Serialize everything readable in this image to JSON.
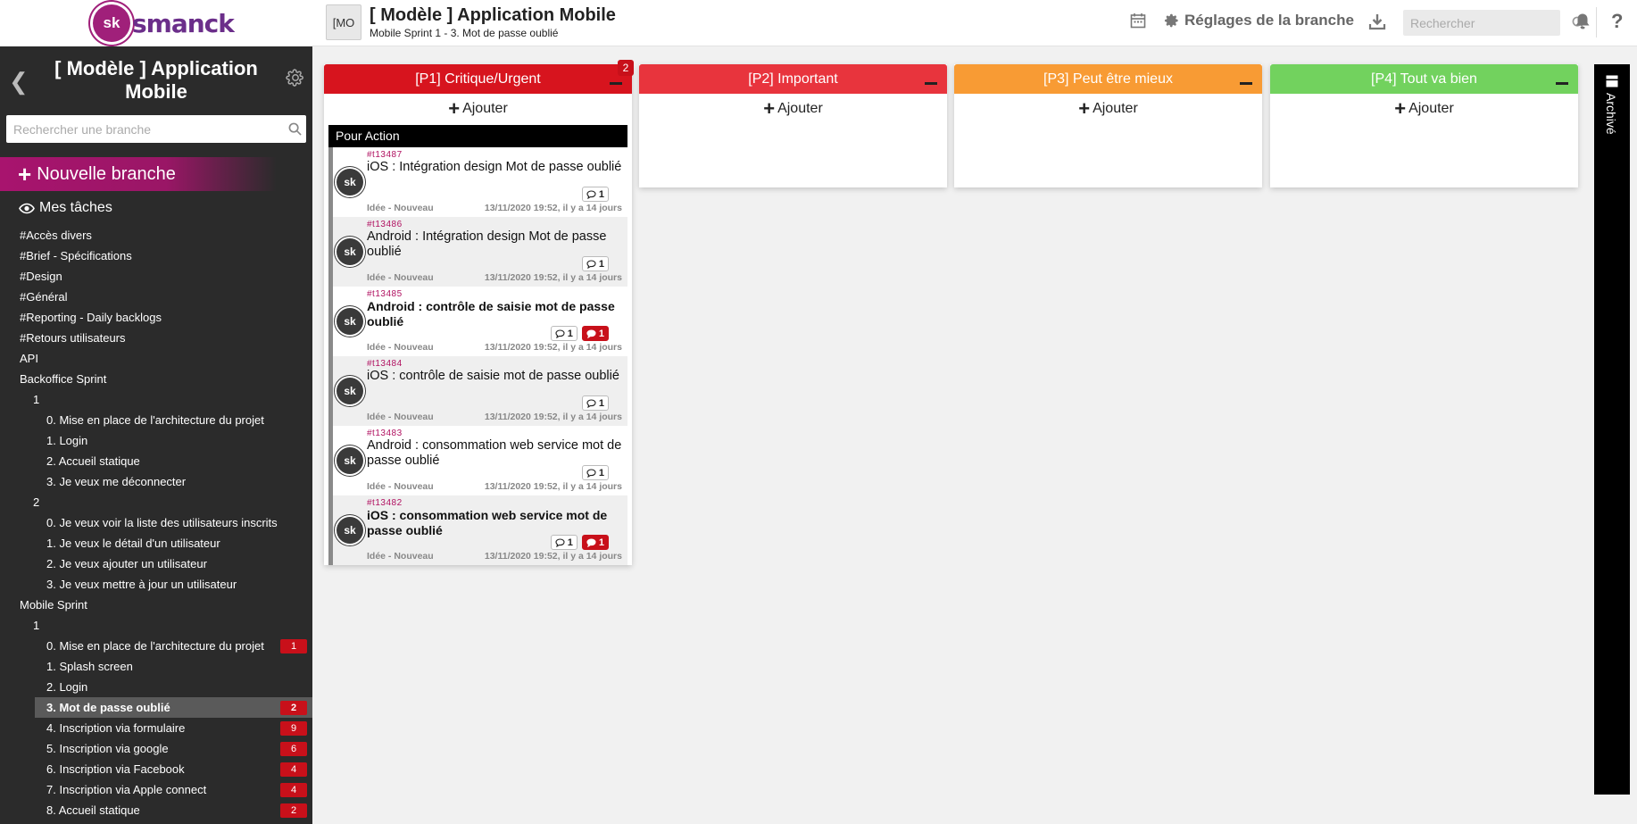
{
  "app": {
    "logo_mark": "sk",
    "logo_text": "smanck",
    "accent": "#a8146e"
  },
  "sidebar": {
    "title": "[ Modèle ] Application Mobile",
    "search_placeholder": "Rechercher une branche",
    "new_branch_label": "Nouvelle branche",
    "my_tasks_label": "Mes tâches",
    "items": [
      {
        "label": "#Accès divers",
        "level": 0,
        "badge": ""
      },
      {
        "label": "#Brief - Spécifications",
        "level": 0,
        "badge": ""
      },
      {
        "label": "#Design",
        "level": 0,
        "badge": ""
      },
      {
        "label": "#Général",
        "level": 0,
        "badge": ""
      },
      {
        "label": "#Reporting - Daily backlogs",
        "level": 0,
        "badge": ""
      },
      {
        "label": "#Retours utilisateurs",
        "level": 0,
        "badge": ""
      },
      {
        "label": "API",
        "level": 0,
        "badge": ""
      },
      {
        "label": "Backoffice Sprint",
        "level": 0,
        "badge": ""
      },
      {
        "label": "1",
        "level": 1,
        "badge": ""
      },
      {
        "label": "0. Mise en place de l'architecture du projet",
        "level": 2,
        "badge": ""
      },
      {
        "label": "1. Login",
        "level": 2,
        "badge": ""
      },
      {
        "label": "2. Accueil statique",
        "level": 2,
        "badge": ""
      },
      {
        "label": "3. Je veux me déconnecter",
        "level": 2,
        "badge": ""
      },
      {
        "label": "2",
        "level": 1,
        "badge": ""
      },
      {
        "label": "0. Je veux voir la liste des utilisateurs inscrits",
        "level": 2,
        "badge": ""
      },
      {
        "label": "1. Je veux le détail d'un utilisateur",
        "level": 2,
        "badge": ""
      },
      {
        "label": "2. Je veux ajouter un utilisateur",
        "level": 2,
        "badge": ""
      },
      {
        "label": "3. Je veux mettre à jour un utilisateur",
        "level": 2,
        "badge": ""
      },
      {
        "label": "Mobile Sprint",
        "level": 0,
        "badge": ""
      },
      {
        "label": "1",
        "level": 1,
        "badge": ""
      },
      {
        "label": "0. Mise en place de l'architecture du projet",
        "level": 2,
        "badge": "1"
      },
      {
        "label": "1. Splash screen",
        "level": 2,
        "badge": ""
      },
      {
        "label": "2. Login",
        "level": 2,
        "badge": ""
      },
      {
        "label": "3. Mot de passe oublié",
        "level": 2,
        "badge": "2",
        "active": true
      },
      {
        "label": "4. Inscription via formulaire",
        "level": 2,
        "badge": "9"
      },
      {
        "label": "5. Inscription via google",
        "level": 2,
        "badge": "6"
      },
      {
        "label": "6. Inscription via Facebook",
        "level": 2,
        "badge": "4"
      },
      {
        "label": "7. Inscription via Apple connect",
        "level": 2,
        "badge": "4"
      },
      {
        "label": "8. Accueil statique",
        "level": 2,
        "badge": "2"
      }
    ]
  },
  "topbar": {
    "avatar_text": "[MO",
    "title": "[ Modèle ] Application Mobile",
    "subtitle": "Mobile Sprint 1 - 3. Mot de passe oublié",
    "settings_label": "Réglages de la branche",
    "search_placeholder": "Rechercher",
    "help_label": "?"
  },
  "columns": [
    {
      "title": "[P1] Critique/Urgent",
      "color": "#d7141e",
      "count": "2",
      "add_label": "Ajouter",
      "group": "Pour Action",
      "tasks": [
        {
          "id": "#t13487",
          "title": "iOS : Intégration design Mot de passe oublié",
          "bold": false,
          "comments": "1",
          "alerts": "",
          "status": "Idée - Nouveau",
          "date": "13/11/2020 19:52, il y a 14 jours"
        },
        {
          "id": "#t13486",
          "title": "Android : Intégration design Mot de passe oublié",
          "bold": false,
          "comments": "1",
          "alerts": "",
          "status": "Idée - Nouveau",
          "date": "13/11/2020 19:52, il y a 14 jours"
        },
        {
          "id": "#t13485",
          "title": "Android : contrôle de saisie mot de passe oublié",
          "bold": true,
          "comments": "1",
          "alerts": "1",
          "status": "Idée - Nouveau",
          "date": "13/11/2020 19:52, il y a 14 jours"
        },
        {
          "id": "#t13484",
          "title": "iOS : contrôle de saisie mot de passe oublié",
          "bold": false,
          "comments": "1",
          "alerts": "",
          "status": "Idée - Nouveau",
          "date": "13/11/2020 19:52, il y a 14 jours"
        },
        {
          "id": "#t13483",
          "title": "Android : consommation web service mot de passe oublié",
          "bold": false,
          "comments": "1",
          "alerts": "",
          "status": "Idée - Nouveau",
          "date": "13/11/2020 19:52, il y a 14 jours"
        },
        {
          "id": "#t13482",
          "title": "iOS : consommation web service mot de passe oublié",
          "bold": true,
          "comments": "1",
          "alerts": "1",
          "status": "Idée - Nouveau",
          "date": "13/11/2020 19:52, il y a 14 jours"
        }
      ]
    },
    {
      "title": "[P2] Important",
      "color": "#e8343d",
      "count": "",
      "add_label": "Ajouter",
      "tasks": []
    },
    {
      "title": "[P3] Peut être mieux",
      "color": "#f89b34",
      "count": "",
      "add_label": "Ajouter",
      "tasks": []
    },
    {
      "title": "[P4] Tout va bien",
      "color": "#72d25e",
      "count": "",
      "add_label": "Ajouter",
      "tasks": []
    }
  ],
  "archive": {
    "label": "Archivé"
  }
}
